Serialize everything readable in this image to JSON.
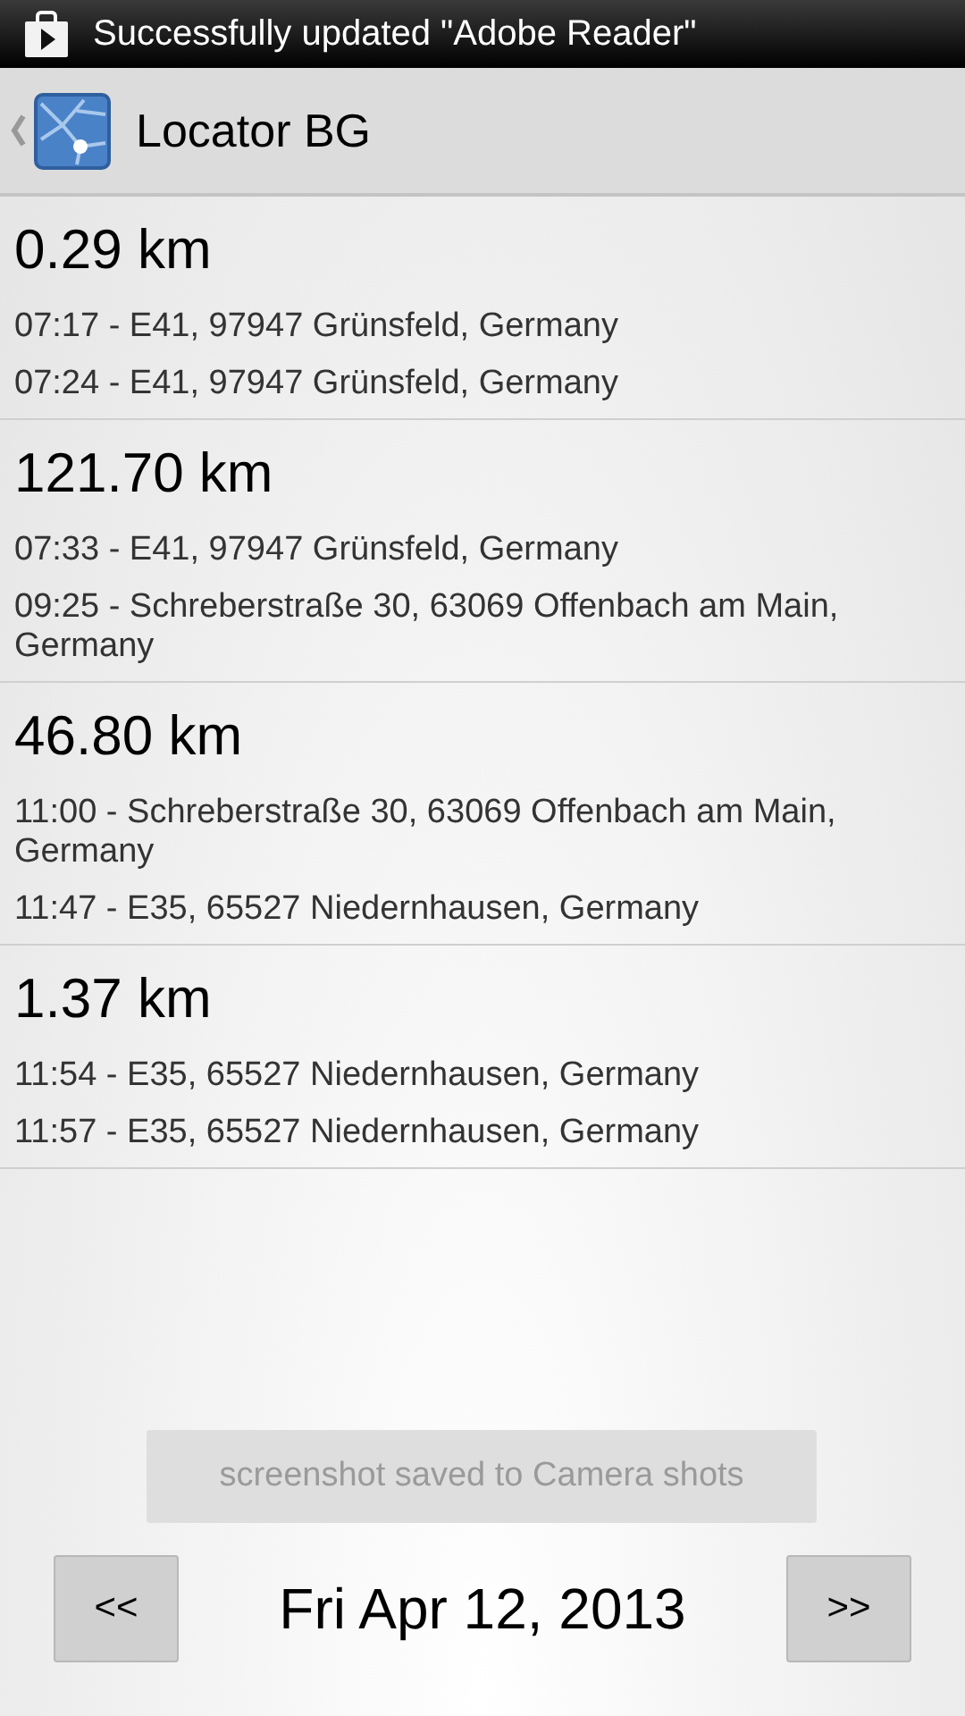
{
  "status_bar": {
    "notification": "Successfully updated \"Adobe Reader\""
  },
  "app_bar": {
    "title": "Locator BG"
  },
  "trips": [
    {
      "distance": "0.29 km",
      "stops": [
        "07:17 - E41, 97947 Grünsfeld, Germany",
        "07:24 - E41, 97947 Grünsfeld, Germany"
      ]
    },
    {
      "distance": "121.70 km",
      "stops": [
        "07:33 - E41, 97947 Grünsfeld, Germany",
        "09:25 - Schreberstraße 30, 63069 Offenbach am Main, Germany"
      ]
    },
    {
      "distance": "46.80 km",
      "stops": [
        "11:00 - Schreberstraße 30, 63069 Offenbach am Main, Germany",
        "11:47 - E35, 65527 Niedernhausen, Germany"
      ]
    },
    {
      "distance": "1.37 km",
      "stops": [
        "11:54 - E35, 65527 Niedernhausen, Germany",
        "11:57 - E35, 65527 Niedernhausen, Germany"
      ]
    }
  ],
  "toast": "screenshot saved to Camera shots",
  "date_nav": {
    "previous": "<<",
    "date": "Fri Apr 12, 2013",
    "next": ">>"
  }
}
